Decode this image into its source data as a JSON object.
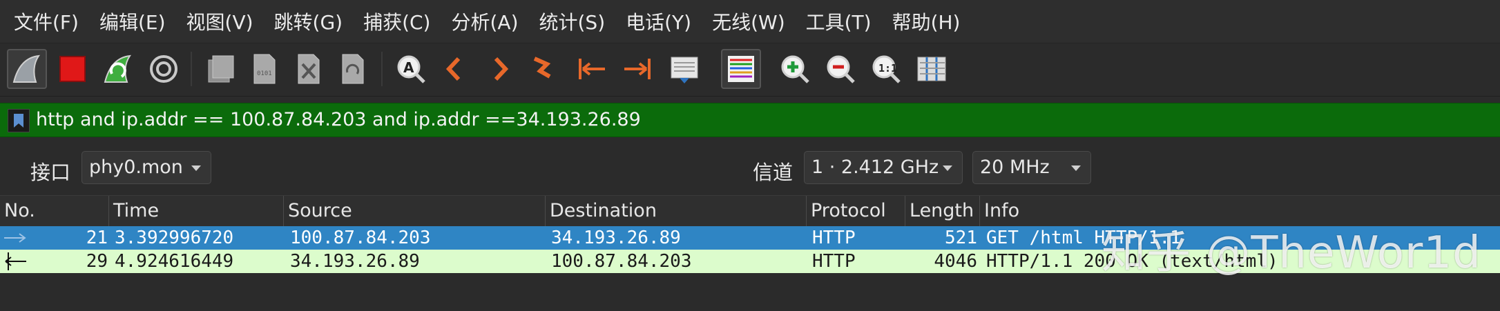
{
  "menu": [
    {
      "label": "文件(F)"
    },
    {
      "label": "编辑(E)"
    },
    {
      "label": "视图(V)"
    },
    {
      "label": "跳转(G)"
    },
    {
      "label": "捕获(C)"
    },
    {
      "label": "分析(A)"
    },
    {
      "label": "统计(S)"
    },
    {
      "label": "电话(Y)"
    },
    {
      "label": "无线(W)"
    },
    {
      "label": "工具(T)"
    },
    {
      "label": "帮助(H)"
    }
  ],
  "toolbar": {
    "icons": [
      "shark-fin-start-icon",
      "stop-square-icon",
      "restart-capture-icon",
      "capture-options-gear-icon",
      "open-file-icon",
      "save-file-icon",
      "close-file-icon",
      "reload-file-icon",
      "find-packet-icon",
      "go-back-icon",
      "go-forward-icon",
      "go-to-packet-icon",
      "first-packet-icon",
      "last-packet-icon",
      "auto-scroll-icon",
      "colorize-icon",
      "zoom-in-icon",
      "zoom-out-icon",
      "normal-size-icon",
      "resize-columns-icon"
    ]
  },
  "filter": {
    "text": "http and ip.addr == 100.87.84.203 and ip.addr ==34.193.26.89",
    "bg_color": "#0b6b0b"
  },
  "interface": {
    "label": "接口",
    "value": "phy0.mon",
    "channel_label": "信道",
    "channel_value": "1 · 2.412 GHz",
    "width_value": "20 MHz"
  },
  "packet_list": {
    "columns": [
      "No.",
      "Time",
      "Source",
      "Destination",
      "Protocol",
      "Length",
      "Info"
    ],
    "rows": [
      {
        "no": "21",
        "time": "3.392996720",
        "source": "100.87.84.203",
        "destination": "34.193.26.89",
        "protocol": "HTTP",
        "length": "521",
        "info": "GET /html HTTP/1.1",
        "state": "selected"
      },
      {
        "no": "29",
        "time": "4.924616449",
        "source": "34.193.26.89",
        "destination": "100.87.84.203",
        "protocol": "HTTP",
        "length": "4046",
        "info": "HTTP/1.1 200 OK  (text/html)",
        "state": "normal"
      }
    ],
    "selected_color": "#2f85c4",
    "http_row_color": "#dcfccc"
  },
  "watermark": "知乎 @TheWor1d"
}
